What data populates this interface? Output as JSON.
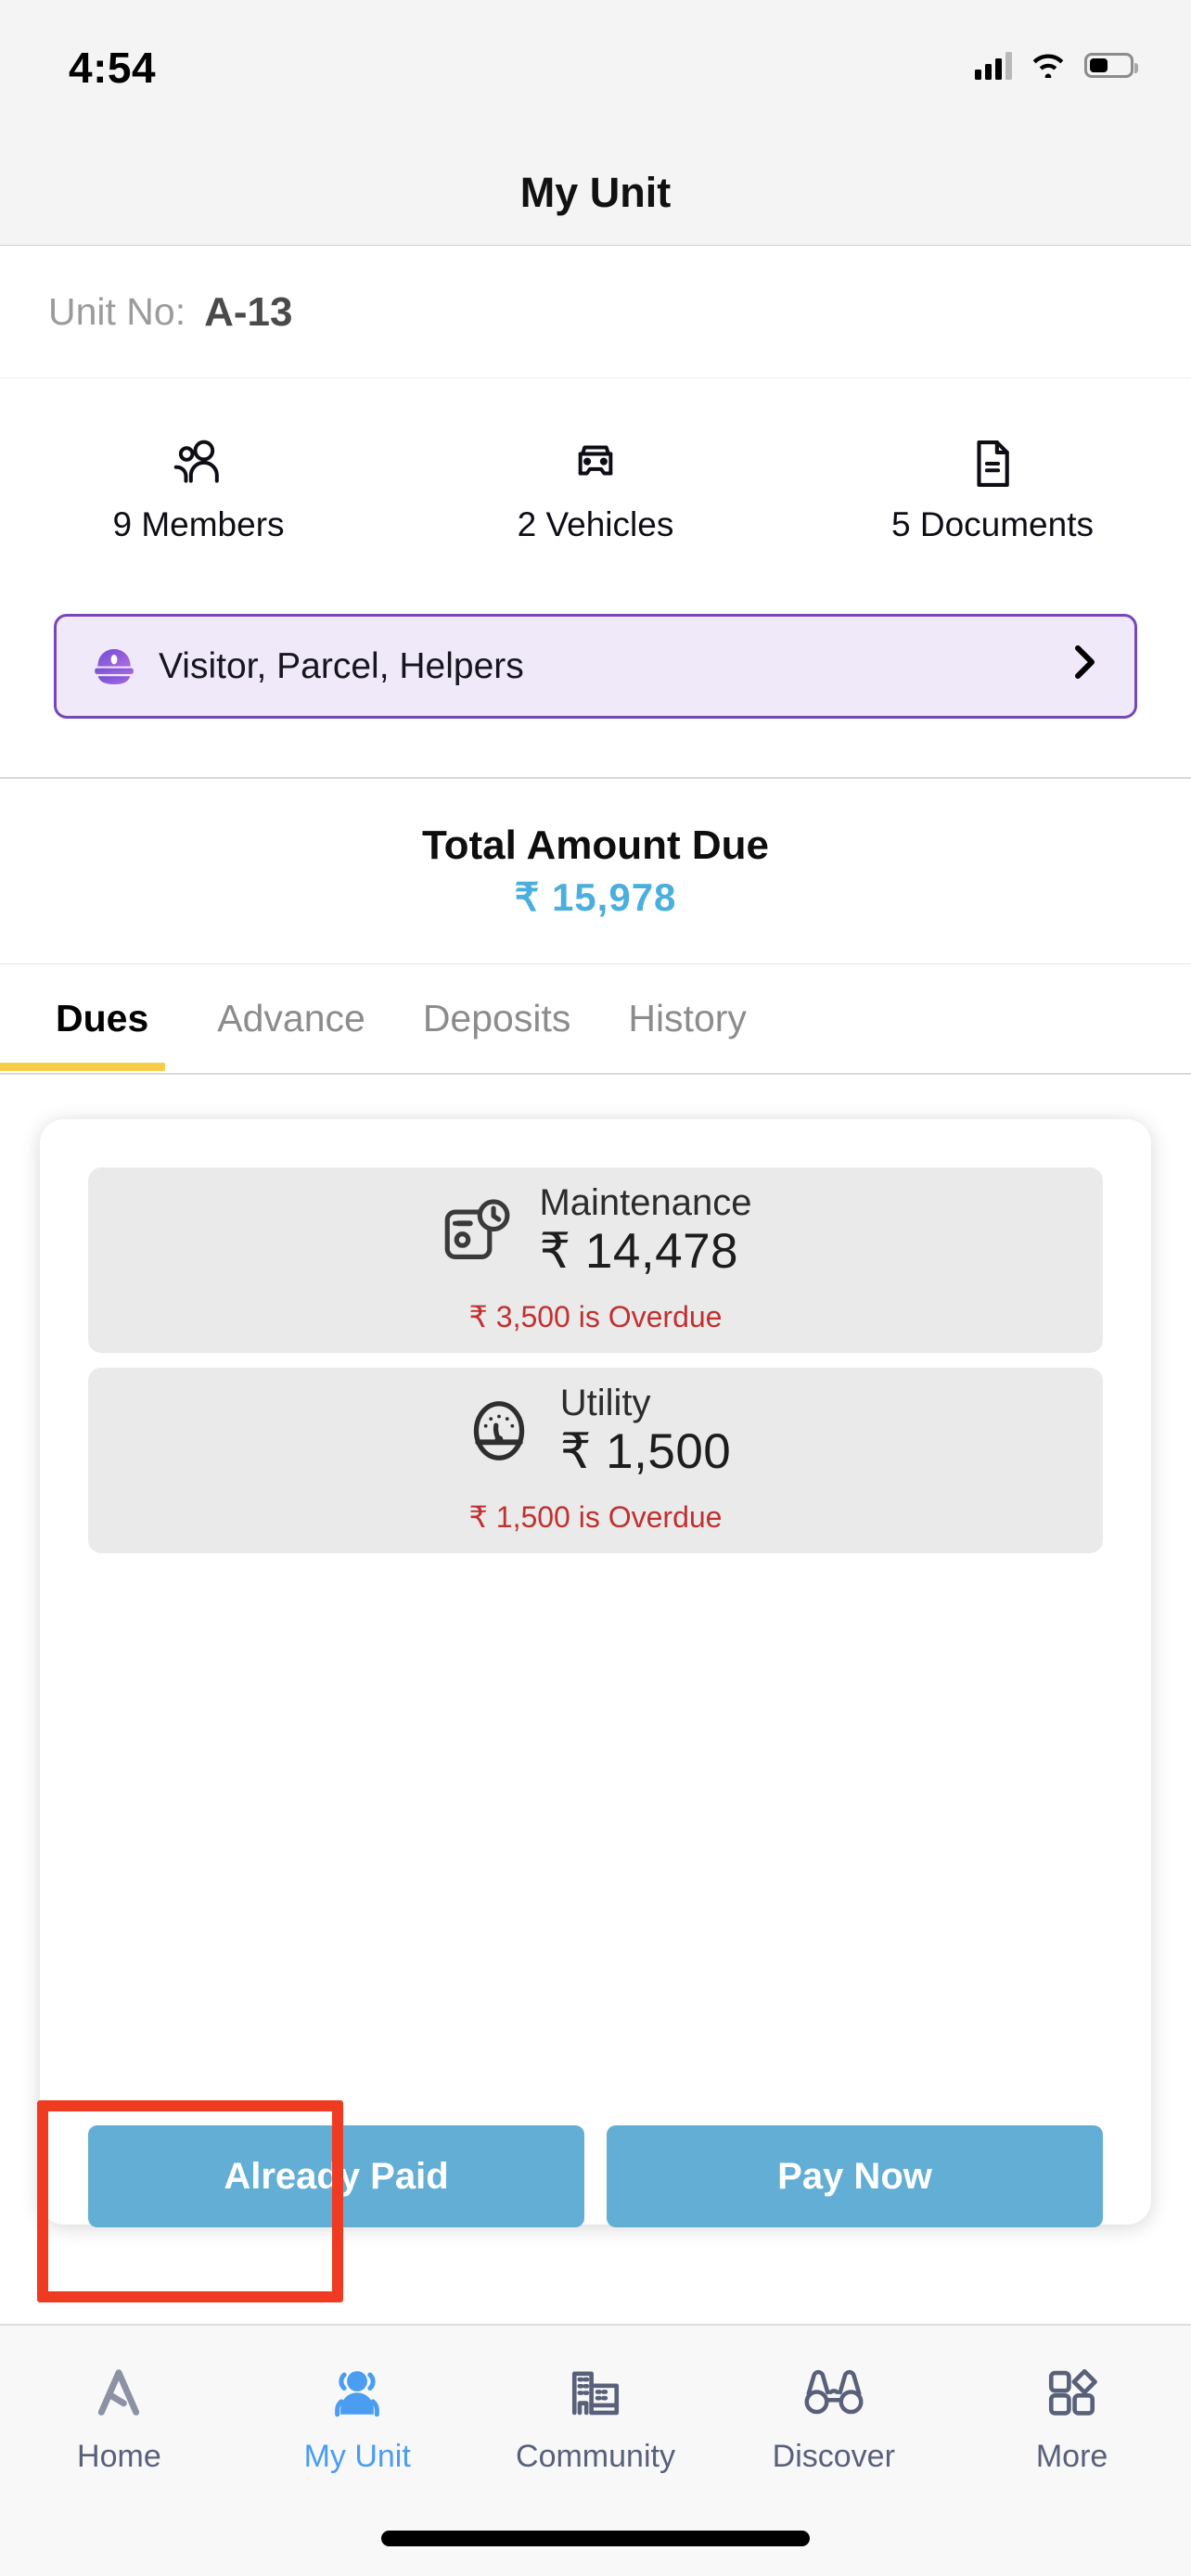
{
  "status_bar": {
    "time": "4:54",
    "signal_icon": "cellular-signal-icon",
    "wifi_icon": "wifi-icon",
    "battery_icon": "battery-icon"
  },
  "header": {
    "title": "My Unit"
  },
  "unit": {
    "label": "Unit No:",
    "value": "A-13"
  },
  "stats": [
    {
      "label": "9 Members",
      "icon": "members-icon"
    },
    {
      "label": "2 Vehicles",
      "icon": "vehicle-icon"
    },
    {
      "label": "5 Documents",
      "icon": "document-icon"
    }
  ],
  "visitor_banner": {
    "label": "Visitor, Parcel, Helpers",
    "icon": "security-guard-cap-icon",
    "chevron": "›",
    "border_color": "#7547b8",
    "background_color": "#efe9fa"
  },
  "total_due": {
    "label": "Total Amount Due",
    "amount": "₹  15,978",
    "color": "#4aaede"
  },
  "tabs": [
    {
      "label": "Dues",
      "active": true
    },
    {
      "label": "Advance",
      "active": false
    },
    {
      "label": "Deposits",
      "active": false
    },
    {
      "label": "History",
      "active": false
    }
  ],
  "tab_indicator_color": "#f6ce49",
  "dues": [
    {
      "title": "Maintenance",
      "amount": "₹ 14,478",
      "overdue": "₹  3,500 is Overdue",
      "icon": "maintenance-clock-icon"
    },
    {
      "title": "Utility",
      "amount": "₹  1,500",
      "overdue": "₹  1,500 is Overdue",
      "icon": "utility-meter-icon"
    }
  ],
  "overdue_color": "#c23030",
  "actions": {
    "already_paid_label": "Already Paid",
    "pay_now_label": "Pay Now",
    "button_color": "#63aed4",
    "highlight_color": "#ee3b22"
  },
  "bottom_nav": [
    {
      "label": "Home",
      "icon": "apartment-a-logo-icon",
      "active": false
    },
    {
      "label": "My Unit",
      "icon": "people-group-icon",
      "active": true
    },
    {
      "label": "Community",
      "icon": "buildings-icon",
      "active": false
    },
    {
      "label": "Discover",
      "icon": "binoculars-icon",
      "active": false
    },
    {
      "label": "More",
      "icon": "grid-shapes-icon",
      "active": false
    }
  ],
  "bottom_nav_active_color": "#4a9df0"
}
